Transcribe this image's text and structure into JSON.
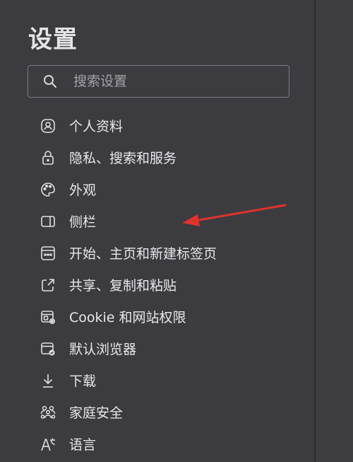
{
  "header": {
    "title": "设置"
  },
  "search": {
    "placeholder": "搜索设置",
    "value": ""
  },
  "sidebar": {
    "items": [
      {
        "label": "个人资料",
        "icon": "profile-icon"
      },
      {
        "label": "隐私、搜索和服务",
        "icon": "lock-icon"
      },
      {
        "label": "外观",
        "icon": "palette-icon"
      },
      {
        "label": "侧栏",
        "icon": "sidebar-panel-icon"
      },
      {
        "label": "开始、主页和新建标签页",
        "icon": "home-tab-icon"
      },
      {
        "label": "共享、复制和粘贴",
        "icon": "share-icon"
      },
      {
        "label": "Cookie 和网站权限",
        "icon": "site-permissions-icon"
      },
      {
        "label": "默认浏览器",
        "icon": "default-browser-icon"
      },
      {
        "label": "下载",
        "icon": "download-icon"
      },
      {
        "label": "家庭安全",
        "icon": "family-icon"
      },
      {
        "label": "语言",
        "icon": "language-icon"
      }
    ]
  },
  "colors": {
    "background": "#3b3b40",
    "text": "#e8e8ec",
    "annotation_arrow": "#e0332b"
  }
}
